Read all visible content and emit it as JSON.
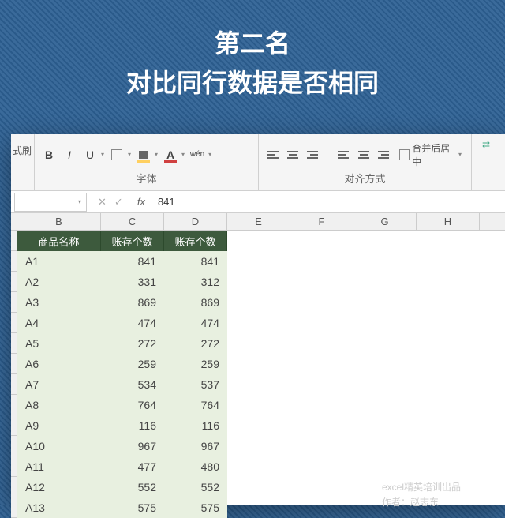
{
  "title": {
    "line1": "第二名",
    "line2": "对比同行数据是否相同"
  },
  "ribbon": {
    "leftStub": "式刷",
    "fontGroup": "字体",
    "alignGroup": "对齐方式",
    "bold": "B",
    "italic": "I",
    "underline": "U",
    "wen": "wén",
    "mergeLabel": "合并后居中"
  },
  "formulaBar": {
    "nameBox": "",
    "fx": "fx",
    "value": "841"
  },
  "columns": [
    "B",
    "C",
    "D",
    "E",
    "F",
    "G",
    "H"
  ],
  "tableHeader": {
    "B": "商品名称",
    "C": "账存个数",
    "D": "账存个数"
  },
  "rows": [
    {
      "B": "A1",
      "C": "841",
      "D": "841"
    },
    {
      "B": "A2",
      "C": "331",
      "D": "312"
    },
    {
      "B": "A3",
      "C": "869",
      "D": "869"
    },
    {
      "B": "A4",
      "C": "474",
      "D": "474"
    },
    {
      "B": "A5",
      "C": "272",
      "D": "272"
    },
    {
      "B": "A6",
      "C": "259",
      "D": "259"
    },
    {
      "B": "A7",
      "C": "534",
      "D": "537"
    },
    {
      "B": "A8",
      "C": "764",
      "D": "764"
    },
    {
      "B": "A9",
      "C": "116",
      "D": "116"
    },
    {
      "B": "A10",
      "C": "967",
      "D": "967"
    },
    {
      "B": "A11",
      "C": "477",
      "D": "480"
    },
    {
      "B": "A12",
      "C": "552",
      "D": "552"
    },
    {
      "B": "A13",
      "C": "575",
      "D": "575"
    }
  ],
  "watermark": {
    "line1": "excel精英培训出品",
    "line2": "作者：赵志东"
  }
}
